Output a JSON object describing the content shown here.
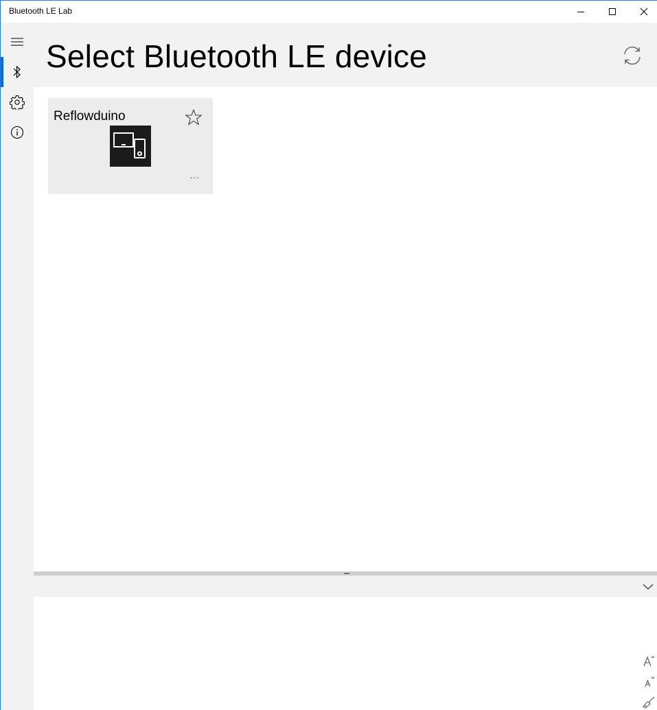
{
  "window": {
    "title": "Bluetooth LE Lab",
    "accent_color": "#0a6ed1"
  },
  "caption_buttons": {
    "minimize_icon": "minimize-icon",
    "maximize_icon": "maximize-icon",
    "close_icon": "close-icon"
  },
  "nav": {
    "items": [
      {
        "icon": "hamburger-menu-icon"
      },
      {
        "icon": "bluetooth-icon",
        "selected": true
      },
      {
        "icon": "gear-icon"
      },
      {
        "icon": "info-icon"
      }
    ]
  },
  "header": {
    "title": "Select Bluetooth LE device",
    "refresh_icon": "refresh-icon"
  },
  "devices": [
    {
      "name": "Reflowduino",
      "icon": "devices-icon",
      "favorite_icon": "star-outline-icon",
      "more_label": "..."
    }
  ],
  "log_panel": {
    "collapse_icon": "chevron-down-icon",
    "tools": [
      "font-increase-icon",
      "font-decrease-icon",
      "clear-brush-icon"
    ]
  }
}
